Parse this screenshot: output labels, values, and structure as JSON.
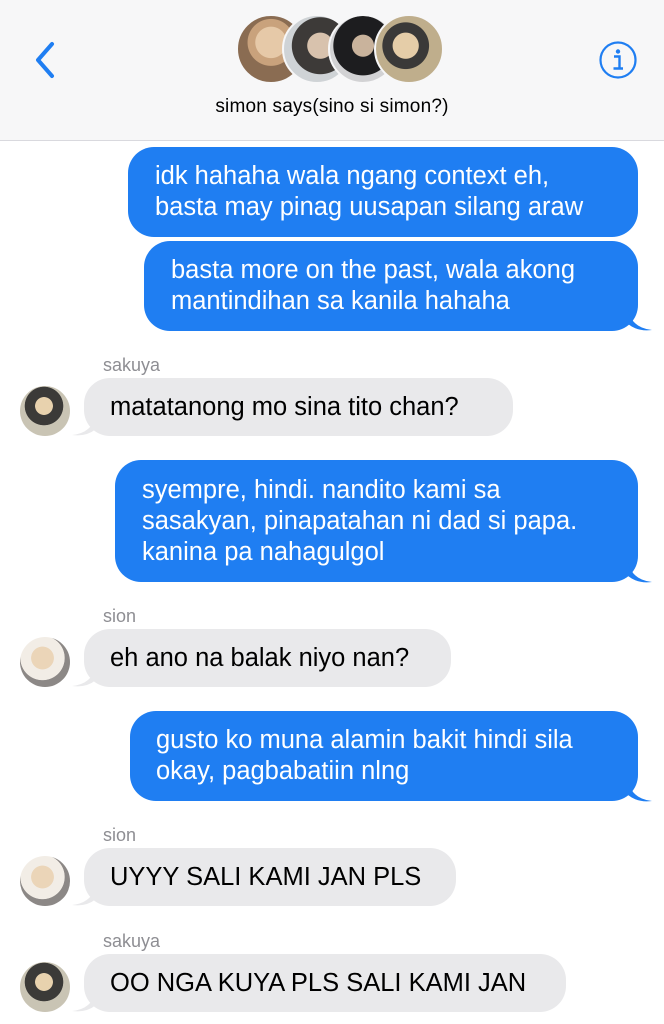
{
  "header": {
    "group_name": "simon says(sino si simon?)",
    "back_icon": "chevron-left-icon",
    "info_icon": "info-circle-icon",
    "accent_color": "#1f7ef2"
  },
  "messages": [
    {
      "type": "outgoing",
      "lines": [
        "idk hahaha wala ngang context eh,",
        "basta may pinag uusapan silang araw"
      ]
    },
    {
      "type": "outgoing",
      "lines": [
        "basta more on the past, wala akong",
        "mantindihan sa kanila hahaha"
      ]
    },
    {
      "type": "incoming",
      "sender": "sakuya",
      "lines": [
        "matatanong mo sina tito chan?"
      ]
    },
    {
      "type": "outgoing",
      "lines": [
        "syempre, hindi. nandito kami sa",
        "sasakyan, pinapatahan ni dad si papa.",
        "kanina pa nahagulgol"
      ]
    },
    {
      "type": "incoming",
      "sender": "sion",
      "lines": [
        "eh ano na balak niyo nan?"
      ]
    },
    {
      "type": "outgoing",
      "lines": [
        "gusto ko muna alamin bakit hindi sila",
        "okay, pagbabatiin nlng"
      ]
    },
    {
      "type": "incoming",
      "sender": "sion",
      "lines": [
        "UYYY SALI KAMI JAN PLS"
      ]
    },
    {
      "type": "incoming",
      "sender": "sakuya",
      "lines": [
        "OO NGA KUYA PLS SALI KAMI JAN"
      ]
    }
  ]
}
